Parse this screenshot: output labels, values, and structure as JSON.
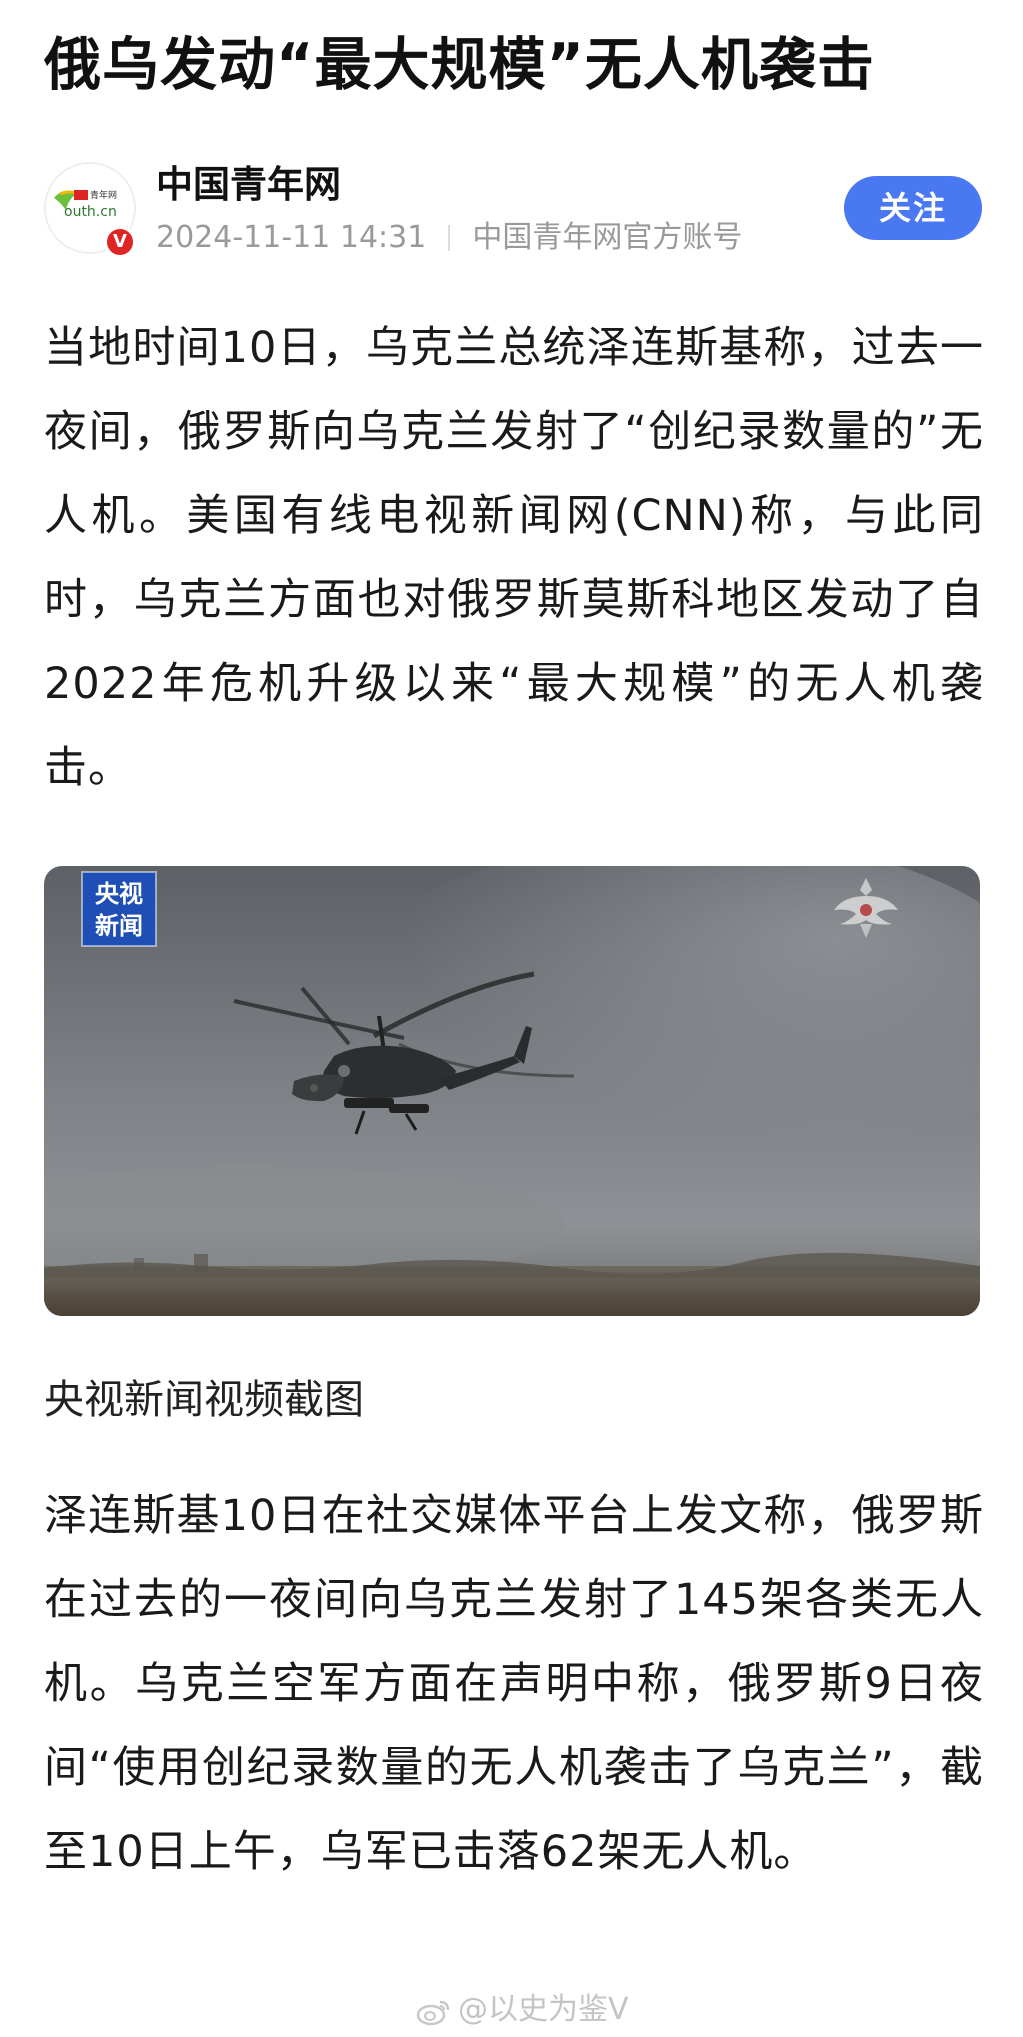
{
  "article": {
    "title": "俄乌发动“最大规模”无人机袭击",
    "author": {
      "name": "中国青年网",
      "avatar_logo_text": "中青网 youth.cn",
      "timestamp": "2024-11-11 14:31",
      "account_type": "中国青年网官方账号",
      "follow_label": "关注",
      "verified_icon": "verified-v-icon"
    },
    "paragraphs": [
      "当地时间10日，乌克兰总统泽连斯基称，过去一夜间，俄罗斯向乌克兰发射了“创纪录数量的”无人机。美国有线电视新闻网(CNN)称，与此同时，乌克兰方面也对俄罗斯莫斯科地区发动了自2022年危机升级以来“最大规模”的无人机袭击。",
      "泽连斯基10日在社交媒体平台上发文称，俄罗斯在过去的一夜间向乌克兰发射了145架各类无人机。乌克兰空军方面在声明中称，俄罗斯9日夜间“使用创纪录数量的无人机袭击了乌克兰”，截至10日上午，乌军已击落62架无人机。"
    ],
    "image": {
      "channel_logo": "央视新闻",
      "emblem": "double-headed-eagle-emblem",
      "subject": "helicopter"
    },
    "image_caption": "央视新闻视频截图"
  },
  "watermark": {
    "text": "@以史为鉴V",
    "icon": "weibo-icon"
  },
  "colors": {
    "accent": "#4a78f0",
    "verified": "#e02424",
    "meta_text": "#9a9a9a",
    "cctv_blue": "#1f4fb5"
  }
}
